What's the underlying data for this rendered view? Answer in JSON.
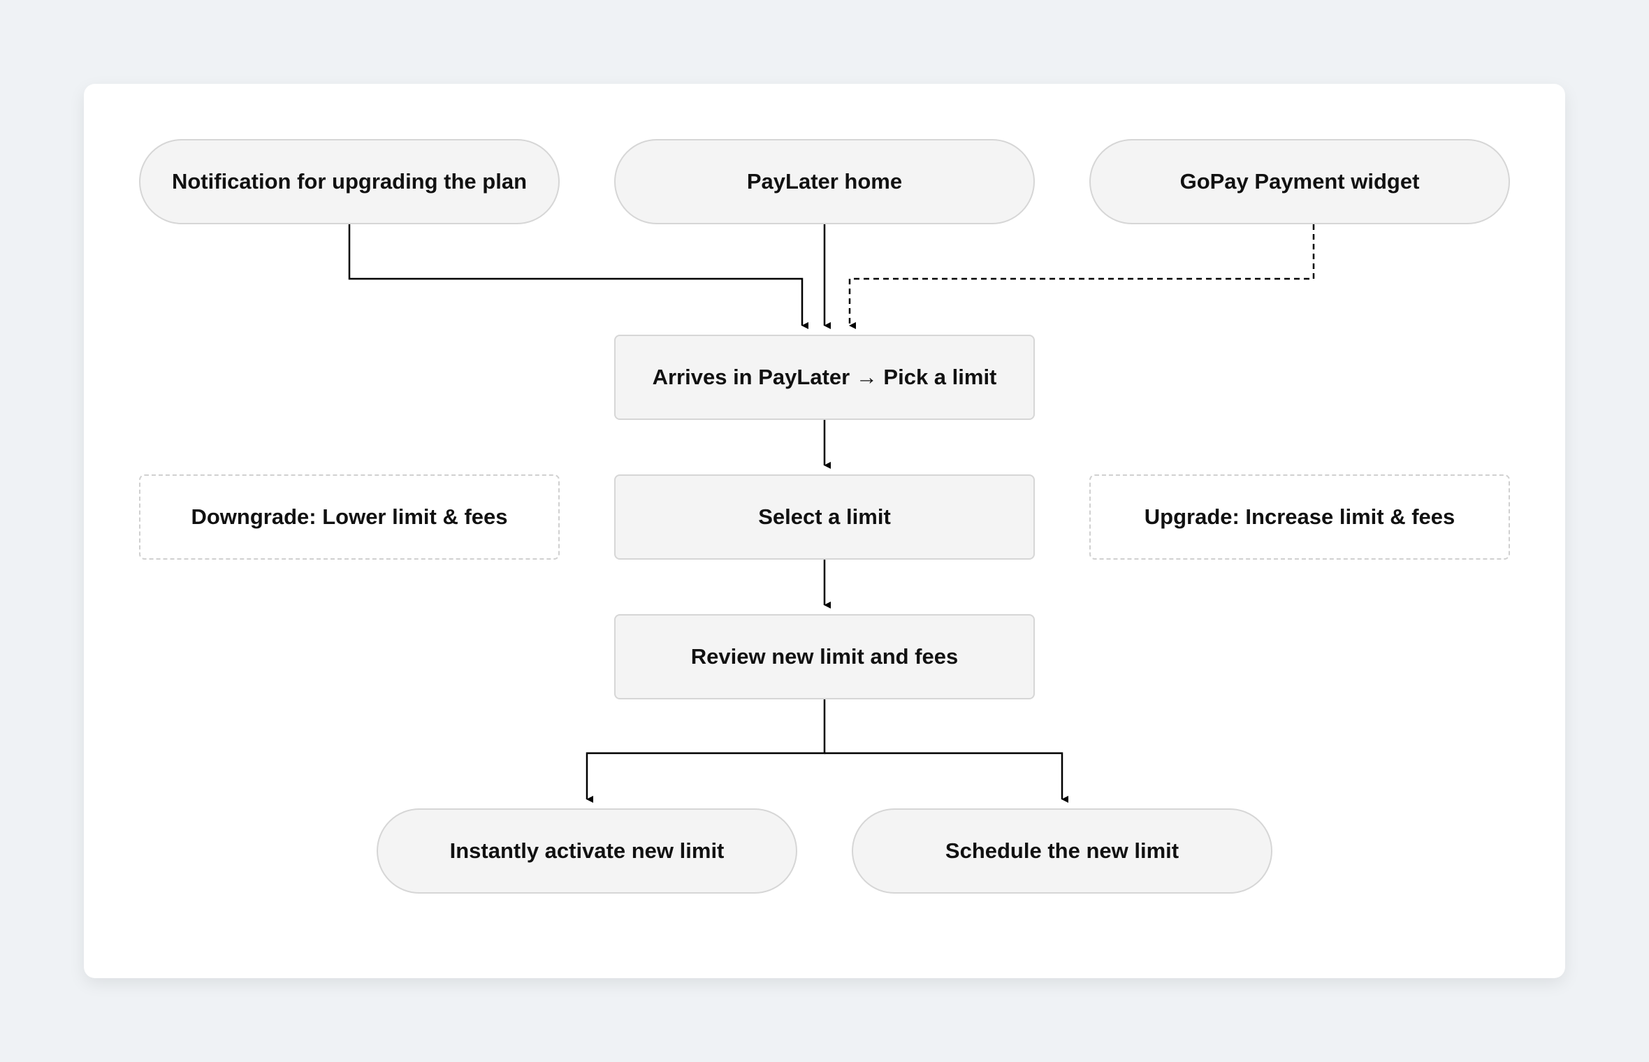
{
  "diagram": {
    "entry_points": [
      {
        "label": "Notification for upgrading the plan"
      },
      {
        "label": "PayLater home"
      },
      {
        "label": "GoPay Payment widget"
      }
    ],
    "steps": [
      {
        "label": "Arrives in PayLater → Pick a limit"
      },
      {
        "label": "Select a limit"
      },
      {
        "label": "Review new limit and fees"
      }
    ],
    "options": [
      {
        "label": "Downgrade: Lower limit & fees"
      },
      {
        "label": "Upgrade: Increase limit & fees"
      }
    ],
    "outcomes": [
      {
        "label": "Instantly activate new limit"
      },
      {
        "label": "Schedule the new limit"
      }
    ]
  }
}
